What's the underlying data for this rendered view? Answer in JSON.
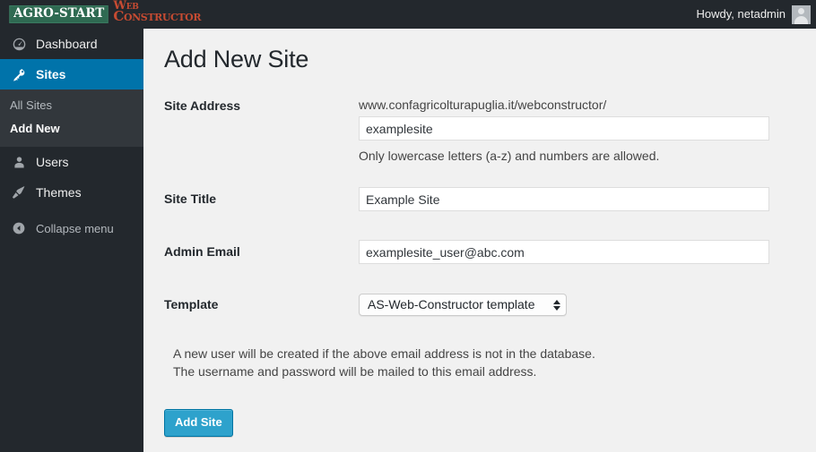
{
  "adminbar": {
    "logo": {
      "badge_text": "AGRO-START",
      "word_line1": "Web",
      "word_line2": "Constructor",
      "badge_bg": "#2f6a52",
      "word_color": "#c64b32"
    },
    "howdy": "Howdy, netadmin",
    "avatar_name": "avatar"
  },
  "sidebar": {
    "items": [
      {
        "label": "Dashboard",
        "icon": "dashboard-icon",
        "active": false
      },
      {
        "label": "Sites",
        "icon": "key-icon",
        "active": true
      },
      {
        "label": "Users",
        "icon": "user-icon",
        "active": false
      },
      {
        "label": "Themes",
        "icon": "brush-icon",
        "active": false
      }
    ],
    "submenu": [
      {
        "label": "All Sites",
        "current": false
      },
      {
        "label": "Add New",
        "current": true
      }
    ],
    "collapse": {
      "label": "Collapse menu",
      "icon": "collapse-arrow-icon"
    },
    "bg": "#23282d",
    "submenu_bg": "#32373c",
    "active_bg": "#0073aa"
  },
  "main": {
    "title": "Add New Site",
    "fields": [
      {
        "label": "Site Address",
        "prefix": "www.confagricolturapuglia.it/webconstructor/",
        "value": "examplesite",
        "placeholder": "",
        "help": "Only lowercase letters (a-z) and numbers are allowed."
      },
      {
        "label": "Site Title",
        "value": "Example Site",
        "placeholder": ""
      },
      {
        "label": "Admin Email",
        "value": "examplesite_user@abc.com",
        "placeholder": ""
      },
      {
        "label": "Template",
        "selected": "AS-Web-Constructor template"
      }
    ],
    "note_line1": "A new user will be created if the above email address is not in the database.",
    "note_line2": "The username and password will be mailed to this email address.",
    "submit_label": "Add Site",
    "submit_color": "#2ea2cc"
  }
}
